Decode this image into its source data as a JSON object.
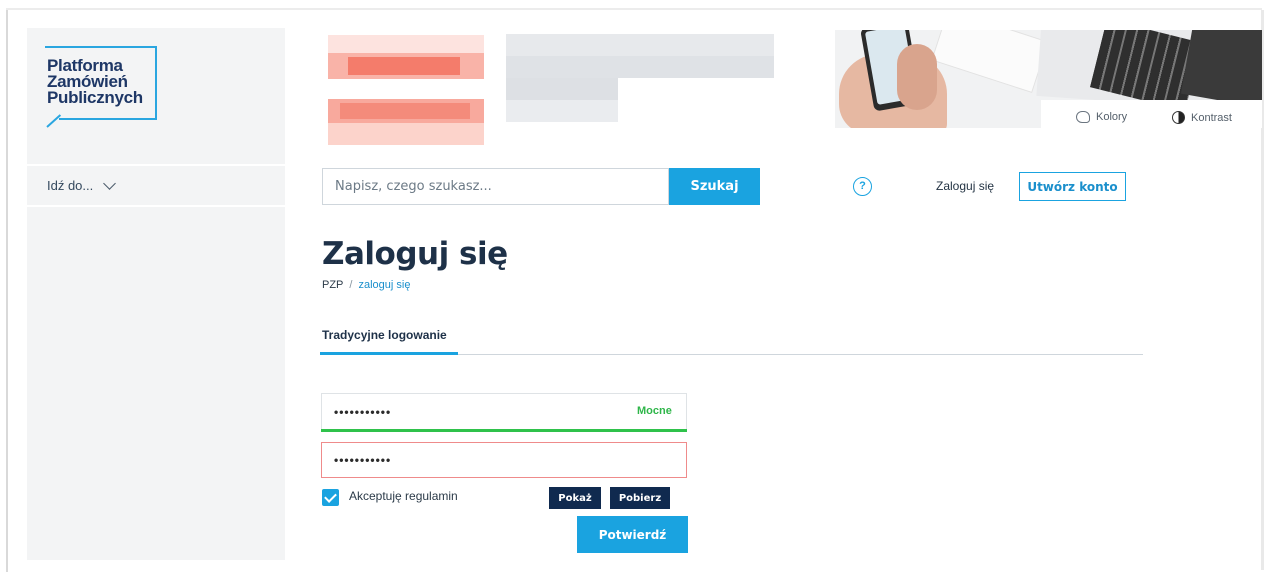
{
  "logo": {
    "lines": [
      "Platforma",
      "Zamówień",
      "Publicznych"
    ]
  },
  "sidebar": {
    "goto_label": "Idź do..."
  },
  "header": {
    "tools": {
      "colors_label": "Kolory",
      "contrast_label": "Kontrast"
    }
  },
  "search": {
    "placeholder": "Napisz, czego szukasz...",
    "button_label": "Szukaj"
  },
  "topnav": {
    "help_icon": "?",
    "login_label": "Zaloguj się",
    "create_account_label": "Utwórz konto"
  },
  "page": {
    "title": "Zaloguj się",
    "breadcrumb": {
      "home": "PZP",
      "separator": "/",
      "current": "zaloguj się"
    }
  },
  "tabs": [
    {
      "label": "Tradycyjne logowanie",
      "active": true
    }
  ],
  "form": {
    "password1_value": "•••••••••••",
    "password1_strength": "Mocne",
    "password2_value": "•••••••••••",
    "terms_label": "Akceptuję regulamin",
    "show_label": "Pokaż",
    "get_label": "Pobierz",
    "submit_label": "Potwierdź"
  },
  "colors": {
    "accent": "#1aa3e0",
    "navy": "#102a4f",
    "strong": "#2fc24b",
    "error": "#ef8b8b"
  }
}
